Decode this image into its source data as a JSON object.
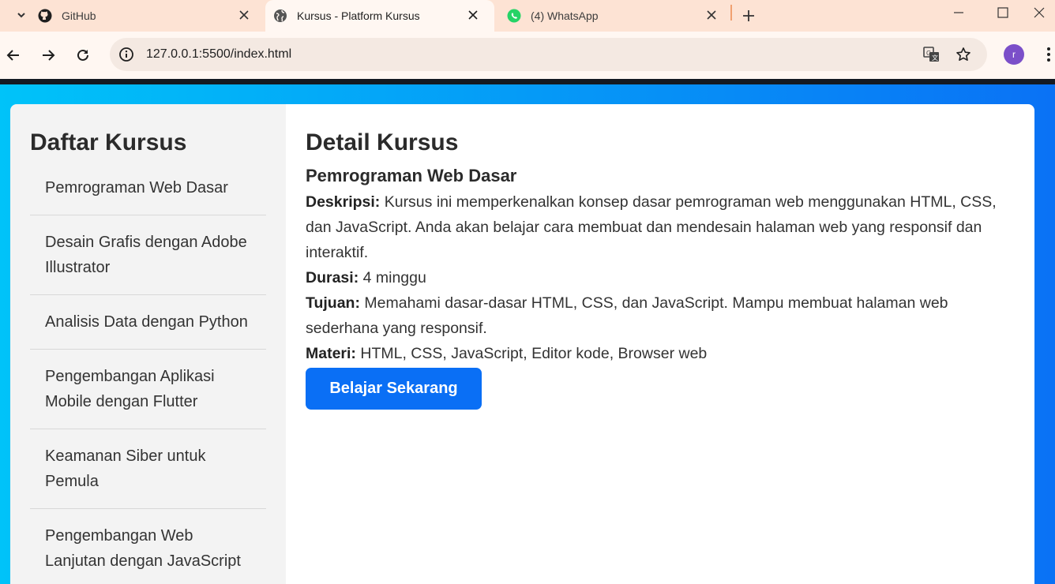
{
  "browser": {
    "tabs": [
      {
        "title": "GitHub",
        "icon": "github-icon"
      },
      {
        "title": "Kursus - Platform Kursus",
        "icon": "globe-icon",
        "active": true
      },
      {
        "title": "(4) WhatsApp",
        "icon": "whatsapp-icon"
      }
    ],
    "url": "127.0.0.1:5500/index.html",
    "profile_initial": "r",
    "accent_color": "#7b4fc9"
  },
  "sidebar": {
    "title": "Daftar Kursus",
    "items": [
      {
        "label": "Pemrograman Web Dasar"
      },
      {
        "label": "Desain Grafis dengan Adobe Illustrator"
      },
      {
        "label": "Analisis Data dengan Python"
      },
      {
        "label": "Pengembangan Aplikasi Mobile dengan Flutter"
      },
      {
        "label": "Keamanan Siber untuk Pemula"
      },
      {
        "label": "Pengembangan Web Lanjutan dengan JavaScript"
      }
    ]
  },
  "detail": {
    "heading": "Detail Kursus",
    "course_title": "Pemrograman Web Dasar",
    "description_label": "Deskripsi:",
    "description": " Kursus ini memperkenalkan konsep dasar pemrograman web menggunakan HTML, CSS, dan JavaScript. Anda akan belajar cara membuat dan mendesain halaman web yang responsif dan interaktif.",
    "duration_label": "Durasi:",
    "duration": " 4 minggu",
    "goal_label": "Tujuan:",
    "goal": " Memahami dasar-dasar HTML, CSS, dan JavaScript. Mampu membuat halaman web sederhana yang responsif.",
    "material_label": "Materi:",
    "material": " HTML, CSS, JavaScript, Editor kode, Browser web",
    "button_label": "Belajar Sekarang",
    "button_color": "#0a6ff5"
  }
}
